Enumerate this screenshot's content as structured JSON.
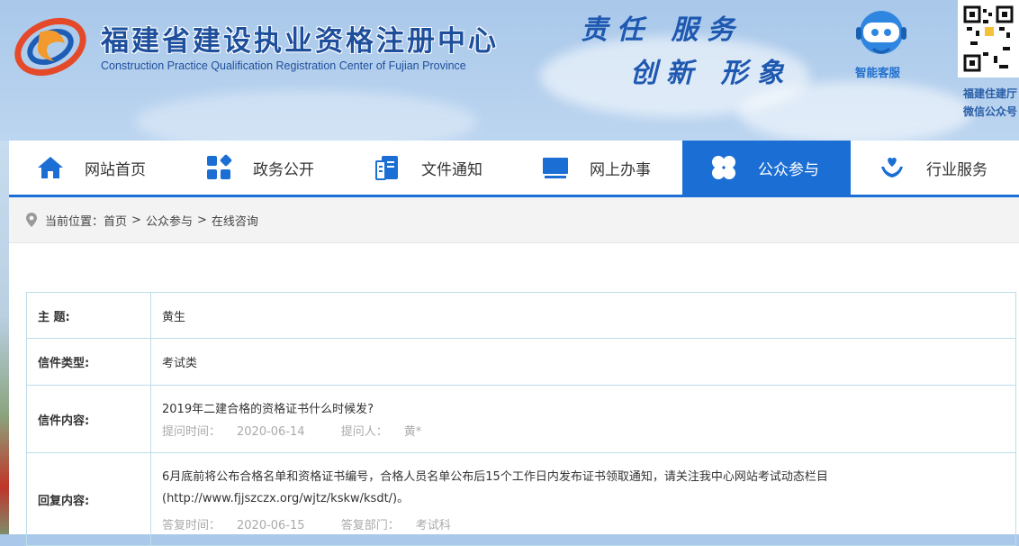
{
  "header": {
    "title": "福建省建设执业资格注册中心",
    "subtitle": "Construction Practice Qualification Registration Center of Fujian Province",
    "slogan_line1": "责任 服务",
    "slogan_line2": "创新 形象",
    "service_label": "智能客服",
    "qr_caption_line1": "福建住建厅",
    "qr_caption_line2": "微信公众号"
  },
  "nav": {
    "items": [
      {
        "label": "网站首页",
        "icon": "home-icon"
      },
      {
        "label": "政务公开",
        "icon": "grid-icon"
      },
      {
        "label": "文件通知",
        "icon": "document-icon"
      },
      {
        "label": "网上办事",
        "icon": "monitor-icon"
      },
      {
        "label": "公众参与",
        "icon": "clover-icon",
        "active": true
      },
      {
        "label": "行业服务",
        "icon": "hand-heart-icon"
      }
    ]
  },
  "breadcrumb": {
    "prefix": "当前位置：",
    "items": [
      "首页",
      "公众参与",
      "在线咨询"
    ],
    "separator": ">"
  },
  "letter": {
    "subject_label": "主 题:",
    "subject": "黄生",
    "type_label": "信件类型:",
    "type": "考试类",
    "content_label": "信件内容:",
    "content": "2019年二建合格的资格证书什么时候发?",
    "ask_time_label": "提问时间：",
    "ask_time": "2020-06-14",
    "asker_label": "提问人：",
    "asker": "黄*",
    "reply_label": "回复内容:",
    "reply": "6月底前将公布合格名单和资格证书编号，合格人员名单公布后15个工作日内发布证书领取通知，请关注我中心网站考试动态栏目(http://www.fjjszczx.org/wjtz/kskw/ksdt/)。",
    "reply_time_label": "答复时间：",
    "reply_time": "2020-06-15",
    "reply_dept_label": "答复部门：",
    "reply_dept": "考试科"
  },
  "colors": {
    "primary": "#1b6ed3",
    "title_blue": "#1e4f9c",
    "table_border": "#bcdde9",
    "meta_gray": "#aaaaaa"
  }
}
